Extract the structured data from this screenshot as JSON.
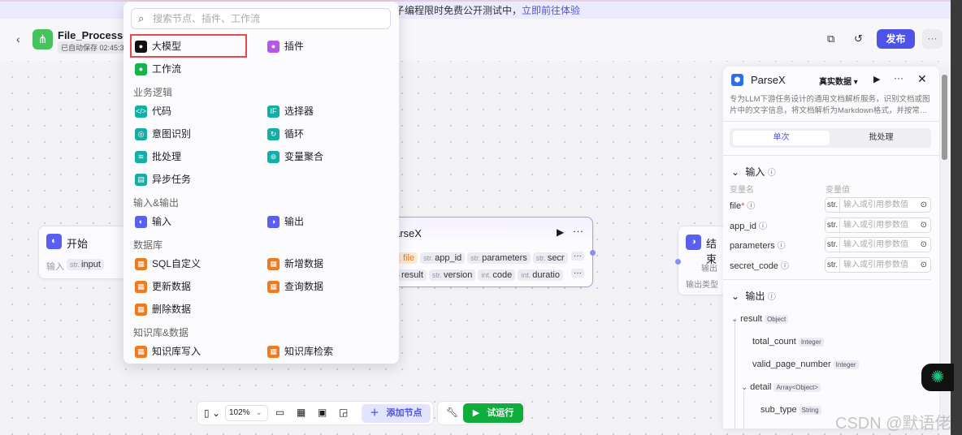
{
  "banner": {
    "text": "子编程限时免费公开测试中，",
    "link": "立即前往体验"
  },
  "header": {
    "title": "File_Processor",
    "saved": "已自动保存 02:45:35",
    "publish": "发布",
    "more": "···"
  },
  "menu": {
    "search_placeholder": "搜索节点、插件、工作流",
    "top": [
      {
        "label": "大模型",
        "color": "#111111"
      },
      {
        "label": "插件",
        "color": "#b558e8"
      },
      {
        "label": "工作流",
        "color": "#16b34a"
      }
    ],
    "sections": [
      {
        "title": "业务逻辑",
        "items": [
          {
            "label": "代码",
            "icon": "</>"
          },
          {
            "label": "选择器",
            "icon": "IF"
          },
          {
            "label": "意图识别",
            "icon": "◎"
          },
          {
            "label": "循环",
            "icon": "↻"
          },
          {
            "label": "批处理",
            "icon": "≋"
          },
          {
            "label": "变量聚合",
            "icon": "⊚"
          },
          {
            "label": "异步任务",
            "icon": "▤"
          }
        ],
        "color": "#13aea5"
      },
      {
        "title": "输入&输出",
        "items": [
          {
            "label": "输入",
            "icon": "◐"
          },
          {
            "label": "输出",
            "icon": "◑"
          }
        ],
        "color": "#5a5ff0"
      },
      {
        "title": "数据库",
        "items": [
          {
            "label": "SQL自定义",
            "icon": "▦"
          },
          {
            "label": "新增数据",
            "icon": "▦"
          },
          {
            "label": "更新数据",
            "icon": "▦"
          },
          {
            "label": "查询数据",
            "icon": "▦"
          },
          {
            "label": "删除数据",
            "icon": "▦"
          }
        ],
        "color": "#f07b1f"
      },
      {
        "title": "知识库&数据",
        "items": [
          {
            "label": "知识库写入",
            "icon": "▦"
          },
          {
            "label": "知识库检索",
            "icon": "▦"
          }
        ],
        "color": "#f07b1f"
      }
    ]
  },
  "start_node": {
    "title": "开始",
    "input_label": "输入",
    "input": {
      "type": "str.",
      "name": "input"
    }
  },
  "parse_node": {
    "title": "arseX",
    "inputs": [
      {
        "type": "r.",
        "name": "file"
      },
      {
        "type": "str.",
        "name": "app_id"
      },
      {
        "type": "str.",
        "name": "parameters"
      },
      {
        "type": "str.",
        "name": "secr"
      }
    ],
    "outputs": [
      {
        "type": "}",
        "name": "result"
      },
      {
        "type": "str.",
        "name": "version"
      },
      {
        "type": "int.",
        "name": "code"
      },
      {
        "type": "int.",
        "name": "duratio"
      }
    ]
  },
  "end_node": {
    "title": "结束",
    "output_label": "输出",
    "output_type_label": "输出类型"
  },
  "panel": {
    "title": "ParseX",
    "data_mode": "真实数据",
    "description": "专为LLM下游任务设计的通用文档解析服务，识别文档或图片中的文字信息，将文档解析为Markdown格式，并按常…",
    "tabs": [
      "单次",
      "批处理"
    ],
    "input_title": "输入",
    "col_name": "变量名",
    "col_value": "变量值",
    "inputs": [
      {
        "name": "file",
        "required": "*",
        "type": "str.",
        "placeholder": "输入或引用参数值"
      },
      {
        "name": "app_id",
        "type": "str.",
        "placeholder": "输入或引用参数值"
      },
      {
        "name": "parameters",
        "type": "str.",
        "placeholder": "输入或引用参数值"
      },
      {
        "name": "secret_code",
        "type": "str.",
        "placeholder": "输入或引用参数值"
      }
    ],
    "output_title": "输出",
    "outputs": [
      {
        "name": "result",
        "type": "Object"
      },
      {
        "name": "total_count",
        "type": "Integer"
      },
      {
        "name": "valid_page_number",
        "type": "Integer"
      },
      {
        "name": "detail",
        "type": "Array<Object>"
      },
      {
        "name": "sub_type",
        "type": "String"
      }
    ]
  },
  "toolbar": {
    "zoom": "102%",
    "add_node": "添加节点",
    "test_run": "试运行"
  },
  "watermark": "CSDN @默语佬"
}
